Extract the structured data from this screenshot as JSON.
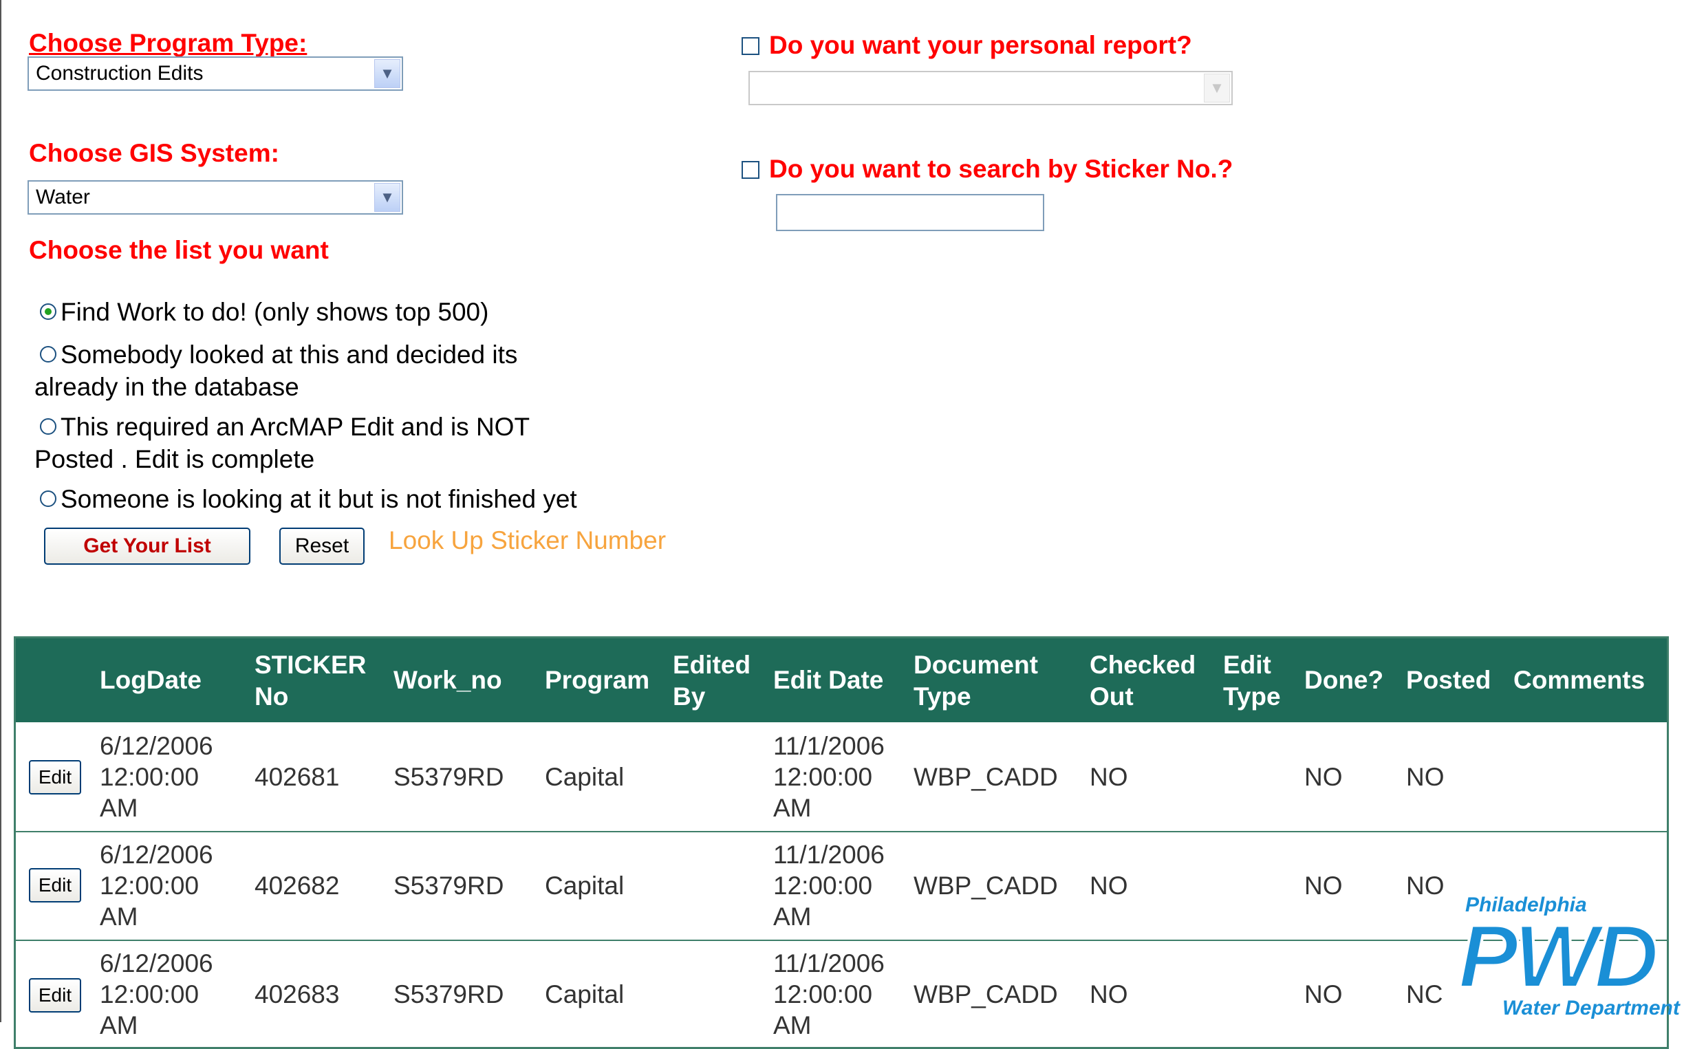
{
  "filters": {
    "program_type_label": "Choose Program Type:",
    "program_type_value": "Construction Edits",
    "gis_system_label": "Choose GIS System:",
    "gis_system_value": "Water",
    "list_label": "Choose the list you want",
    "personal_report_label": "Do you want your personal report?",
    "personal_report_checked": false,
    "personal_report_value": "",
    "sticker_search_label": "Do you want to search by Sticker No.?",
    "sticker_search_checked": false,
    "sticker_search_value": ""
  },
  "list_options": [
    {
      "label": "Find Work to do! (only shows top 500)",
      "selected": true
    },
    {
      "line1": "Somebody looked at this and decided its",
      "line2": "already in the database",
      "selected": false
    },
    {
      "line1": "This required an ArcMAP Edit and is NOT",
      "line2": "Posted . Edit is complete",
      "selected": false
    },
    {
      "label": "Someone is looking at it but is not finished yet",
      "selected": false
    }
  ],
  "actions": {
    "get_list_label": "Get Your List",
    "reset_label": "Reset",
    "lookup_link": "Look Up Sticker Number"
  },
  "table": {
    "headers": {
      "logdate": "LogDate",
      "sticker_1": "STICKER",
      "sticker_2": "No",
      "work_no": "Work_no",
      "program": "Program",
      "edited_1": "Edited",
      "edited_2": "By",
      "edit_date": "Edit Date",
      "doc_1": "Document",
      "doc_2": "Type",
      "checked_1": "Checked",
      "checked_2": "Out",
      "edit_type_1": "Edit",
      "edit_type_2": "Type",
      "done": "Done?",
      "posted": "Posted",
      "comments": "Comments"
    },
    "edit_label": "Edit",
    "rows": [
      {
        "log_1": "6/12/2006",
        "log_2": "12:00:00",
        "log_3": "AM",
        "sticker": "402681",
        "work_no": "S5379RD",
        "program": "Capital",
        "edited_by": "",
        "ed_1": "11/1/2006",
        "ed_2": "12:00:00",
        "ed_3": "AM",
        "doc_type": "WBP_CADD",
        "checked_out": "NO",
        "edit_type": "",
        "done": "NO",
        "posted": "NO",
        "comments": ""
      },
      {
        "log_1": "6/12/2006",
        "log_2": "12:00:00",
        "log_3": "AM",
        "sticker": "402682",
        "work_no": "S5379RD",
        "program": "Capital",
        "edited_by": "",
        "ed_1": "11/1/2006",
        "ed_2": "12:00:00",
        "ed_3": "AM",
        "doc_type": "WBP_CADD",
        "checked_out": "NO",
        "edit_type": "",
        "done": "NO",
        "posted": "NO",
        "comments": ""
      },
      {
        "log_1": "6/12/2006",
        "log_2": "12:00:00",
        "log_3": "AM",
        "sticker": "402683",
        "work_no": "S5379RD",
        "program": "Capital",
        "edited_by": "",
        "ed_1": "11/1/2006",
        "ed_2": "12:00:00",
        "ed_3": "AM",
        "doc_type": "WBP_CADD",
        "checked_out": "NO",
        "edit_type": "",
        "done": "NO",
        "posted": "NC",
        "comments": ""
      }
    ]
  },
  "logo": {
    "top_text": "Philadelphia",
    "mark_text": "PWD",
    "bottom_text": "Water Department",
    "color": "#1a8fd6"
  },
  "colors": {
    "label_red": "#ff0000",
    "header_green": "#1e6b58",
    "link_orange": "#f7a43e"
  }
}
